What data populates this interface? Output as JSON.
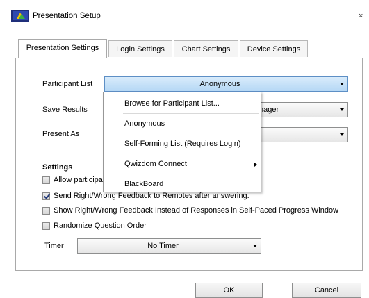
{
  "window": {
    "title": "Presentation Setup",
    "close_glyph": "×",
    "app_icon": "qwizdom-app-icon"
  },
  "tabs": [
    {
      "label": "Presentation Settings",
      "active": true
    },
    {
      "label": "Login Settings",
      "active": false
    },
    {
      "label": "Chart Settings",
      "active": false
    },
    {
      "label": "Device Settings",
      "active": false
    }
  ],
  "form": {
    "participant_list": {
      "label": "Participant List",
      "value": "Anonymous"
    },
    "save_results": {
      "label": "Save Results",
      "value": "nager"
    },
    "present_as": {
      "label": "Present As",
      "value": ""
    }
  },
  "settings": {
    "heading": "Settings",
    "options": [
      {
        "label": "Allow participar",
        "checked": false
      },
      {
        "label": "Send Right/Wrong Feedback to Remotes after answering.",
        "checked": true
      },
      {
        "label": "Show Right/Wrong Feedback Instead of Responses in Self-Paced Progress Window",
        "checked": false
      },
      {
        "label": "Randomize Question Order",
        "checked": false
      }
    ],
    "timer": {
      "label": "Timer",
      "value": "No Timer"
    }
  },
  "dropdown_menu": {
    "items": [
      {
        "label": "Browse for Participant List..."
      },
      {
        "label": "Anonymous"
      },
      {
        "label": "Self-Forming List (Requires Login)"
      },
      {
        "label": "Qwizdom Connect",
        "has_submenu": true
      },
      {
        "label": "BlackBoard"
      }
    ]
  },
  "buttons": {
    "ok": "OK",
    "cancel": "Cancel"
  },
  "colors": {
    "selected_combo": "#b5d8f5",
    "check_mark": "#233a7b"
  }
}
